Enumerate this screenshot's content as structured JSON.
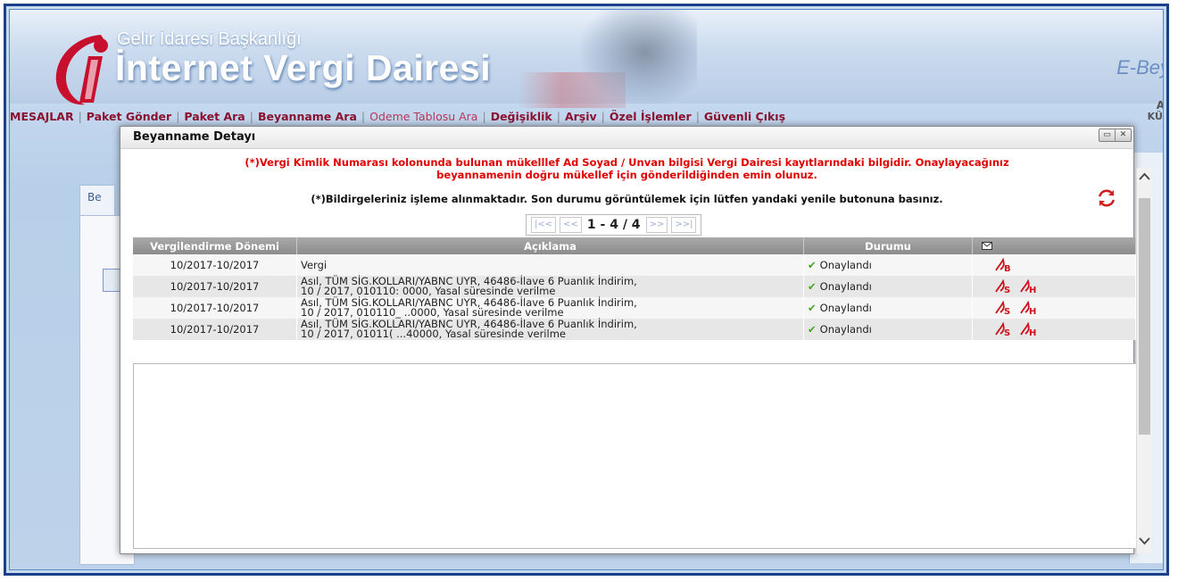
{
  "header": {
    "org_title": "Gelir İdaresi Başkanlığı",
    "main_title": "İnternet Vergi Dairesi",
    "product": "E-Bey"
  },
  "menu": {
    "items": [
      {
        "label": "MESAJLAR"
      },
      {
        "label": "Paket Gönder"
      },
      {
        "label": "Paket Ara"
      },
      {
        "label": "Beyanname Ara"
      },
      {
        "label": "Odeme Tablosu Ara"
      },
      {
        "label": "Değişiklik"
      },
      {
        "label": "Arşiv"
      },
      {
        "label": "Özel İşlemler"
      },
      {
        "label": "Güvenli Çıkış"
      }
    ],
    "separator": "|",
    "right_top": "A",
    "right_label": "KÜÇ"
  },
  "background": {
    "tab_label": "Be"
  },
  "dialog": {
    "title": "Beyanname Detayı",
    "warning_line1": "(*)Vergi Kimlik Numarası kolonunda bulunan mükelllef Ad Soyad / Unvan bilgisi Vergi Dairesi kayıtlarındaki bilgidir. Onaylayacağınız",
    "warning_line2": "beyannamenin doğru mükellef için gönderildiğinden emin olunuz.",
    "info": "(*)Bildirgeleriniz işleme alınmaktadır. Son durumu görüntülemek için lütfen yandaki yenile butonuna basınız.",
    "pager": {
      "first": "|<<",
      "prev": "<<",
      "info": "1 - 4 / 4",
      "next": ">>",
      "last": ">>|"
    },
    "columns": {
      "donem": "Vergilendirme Dönemi",
      "aciklama": "Açıklama",
      "durum": "Durumu"
    },
    "rows": [
      {
        "donem": "10/2017-10/2017",
        "aciklama1": "Vergi",
        "aciklama2": "",
        "durum": "Onaylandı",
        "icons": [
          "B"
        ]
      },
      {
        "donem": "10/2017-10/2017",
        "aciklama1": "Asıl, TÜM SİG.KOLLARI/YABNC UYR, 46486-İlave 6 Puanlık İndirim,",
        "aciklama2": "10 / 2017, 010110:           0000, Yasal süresinde verilme",
        "durum": "Onaylandı",
        "icons": [
          "S",
          "H"
        ]
      },
      {
        "donem": "10/2017-10/2017",
        "aciklama1": "Asıl, TÜM SİG.KOLLARI/YABNC UYR, 46486-İlave 6 Puanlık İndirim,",
        "aciklama2": "10 / 2017, 010110_      ..0000, Yasal süresinde verilme",
        "durum": "Onaylandı",
        "icons": [
          "S",
          "H"
        ]
      },
      {
        "donem": "10/2017-10/2017",
        "aciklama1": "Asıl, TÜM SİG.KOLLARI/YABNC UYR, 46486-İlave 6 Puanlık İndirim,",
        "aciklama2": "10 / 2017, 01011(      ...40000, Yasal süresinde verilme",
        "durum": "Onaylandı",
        "icons": [
          "S",
          "H"
        ]
      }
    ]
  },
  "colors": {
    "menu_text": "#8a1230",
    "warning": "#e00000",
    "status_ok": "#45a51c",
    "pdf_red": "#d0101c"
  },
  "icons": {
    "refresh": "refresh-icon",
    "mail": "envelope-icon",
    "pdf": "pdf-icon",
    "check": "check-icon"
  }
}
